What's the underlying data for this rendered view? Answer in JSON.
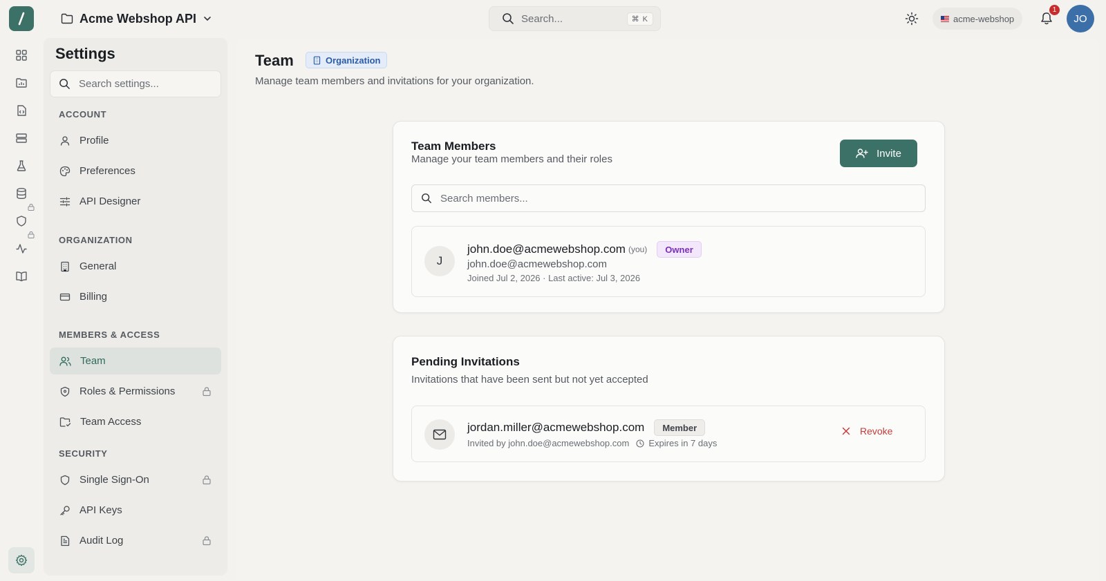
{
  "topbar": {
    "project_name": "Acme Webshop API",
    "search_placeholder": "Search...",
    "search_shortcut": "⌘ K",
    "workspace": "acme-webshop",
    "notification_count": "1",
    "user_initials": "JO"
  },
  "settings": {
    "title": "Settings",
    "search_placeholder": "Search settings...",
    "groups": {
      "account": "ACCOUNT",
      "organization": "ORGANIZATION",
      "members": "MEMBERS & ACCESS",
      "security": "SECURITY"
    },
    "items": {
      "profile": "Profile",
      "preferences": "Preferences",
      "api_designer": "API Designer",
      "general": "General",
      "billing": "Billing",
      "team": "Team",
      "roles": "Roles & Permissions",
      "team_access": "Team Access",
      "sso": "Single Sign-On",
      "api_keys": "API Keys",
      "audit_log": "Audit Log"
    }
  },
  "page": {
    "title": "Team",
    "badge": "Organization",
    "subtitle": "Manage team members and invitations for your organization."
  },
  "members_card": {
    "title": "Team Members",
    "subtitle": "Manage your team members and their roles",
    "invite_label": "Invite",
    "search_placeholder": "Search members...",
    "member": {
      "initial": "J",
      "name": "john.doe@acmewebshop.com",
      "you": "(you)",
      "role": "Owner",
      "email": "john.doe@acmewebshop.com",
      "meta": "Joined Jul 2, 2026 · Last active: Jul 3, 2026"
    }
  },
  "invites_card": {
    "title": "Pending Invitations",
    "subtitle": "Invitations that have been sent but not yet accepted",
    "invite": {
      "email": "jordan.miller@acmewebshop.com",
      "role": "Member",
      "invited_by": "Invited by john.doe@acmewebshop.com",
      "expires": "Expires in 7 days",
      "revoke_label": "Revoke"
    }
  },
  "colors": {
    "accent": "#3b7166",
    "owner_badge": "#7a2fb8",
    "org_badge": "#2b5ba6",
    "danger": "#c83a3a",
    "notification": "#c82c2c"
  }
}
